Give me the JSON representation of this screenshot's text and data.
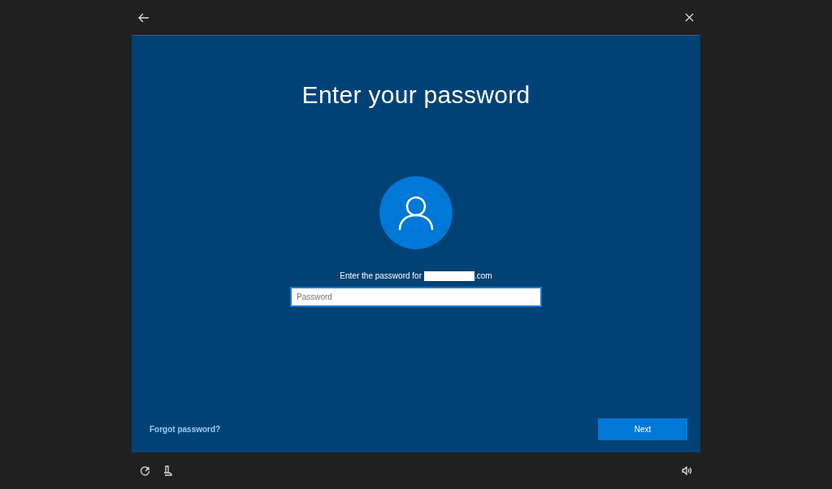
{
  "title": "Enter your password",
  "prompt": {
    "text": "Enter the password for",
    "redacted": true,
    "suffix": ".com"
  },
  "password_field": {
    "placeholder": "Password"
  },
  "forgot_link": "Forgot password?",
  "next_button": "Next"
}
